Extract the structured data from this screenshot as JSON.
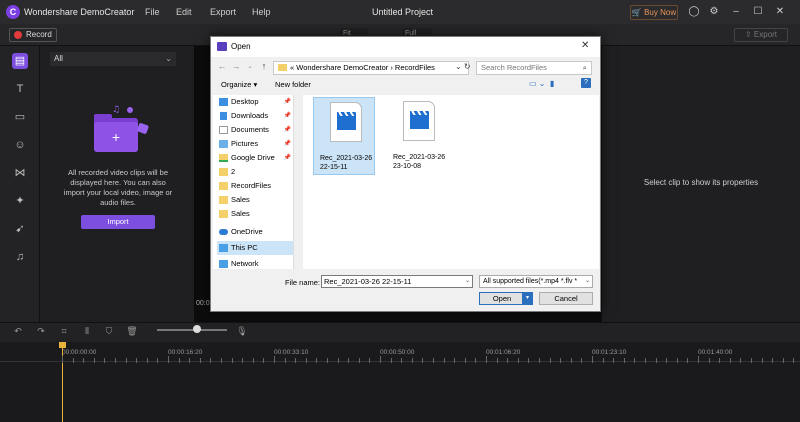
{
  "app": {
    "name": "Wondershare DemoCreator",
    "project": "Untitled Project",
    "buy_now": "Buy Now"
  },
  "menu": [
    "File",
    "Edit",
    "Export",
    "Help"
  ],
  "toolbar": {
    "record": "Record",
    "export": "Export",
    "fit": "Fit",
    "full": "Full"
  },
  "media": {
    "filter": "All",
    "description": "All recorded video clips will be displayed here. You can also import your local video, image or audio files.",
    "import": "Import"
  },
  "preview": {
    "time": "00:00"
  },
  "properties": {
    "message": "Select clip to show its properties"
  },
  "timeline": {
    "ticks": [
      "00:00:00:00",
      "00:00:16:20",
      "00:00:33:10",
      "00:00:50:00",
      "00:01:06:20",
      "00:01:23:10",
      "00:01:40:00"
    ]
  },
  "dialog": {
    "title": "Open",
    "breadcrumb": "«  Wondershare DemoCreator  ›  RecordFiles",
    "search_placeholder": "Search RecordFiles",
    "organize": "Organize ▾",
    "new_folder": "New folder",
    "tree": [
      {
        "label": "Desktop",
        "pinned": true
      },
      {
        "label": "Downloads",
        "pinned": true
      },
      {
        "label": "Documents",
        "pinned": true
      },
      {
        "label": "Pictures",
        "pinned": true
      },
      {
        "label": "Google Drive",
        "pinned": true
      },
      {
        "label": "2",
        "pinned": false
      },
      {
        "label": "RecordFiles",
        "pinned": false
      },
      {
        "label": "Sales",
        "pinned": false
      },
      {
        "label": "Sales",
        "pinned": false
      },
      {
        "label": "OneDrive",
        "pinned": false
      },
      {
        "label": "This PC",
        "pinned": false
      },
      {
        "label": "Network",
        "pinned": false
      }
    ],
    "files": [
      {
        "name": "Rec_2021-03-26 22-15-11",
        "selected": true
      },
      {
        "name": "Rec_2021-03-26 23-10-08",
        "selected": false
      }
    ],
    "file_name_label": "File name:",
    "file_name": "Rec_2021-03-26 22-15-11",
    "file_type": "All supported files(*.mp4 *.flv *",
    "open": "Open",
    "cancel": "Cancel"
  },
  "colors": {
    "accent": "#7c4fe0",
    "playhead": "#e8b33a",
    "record": "#e23b3b"
  }
}
